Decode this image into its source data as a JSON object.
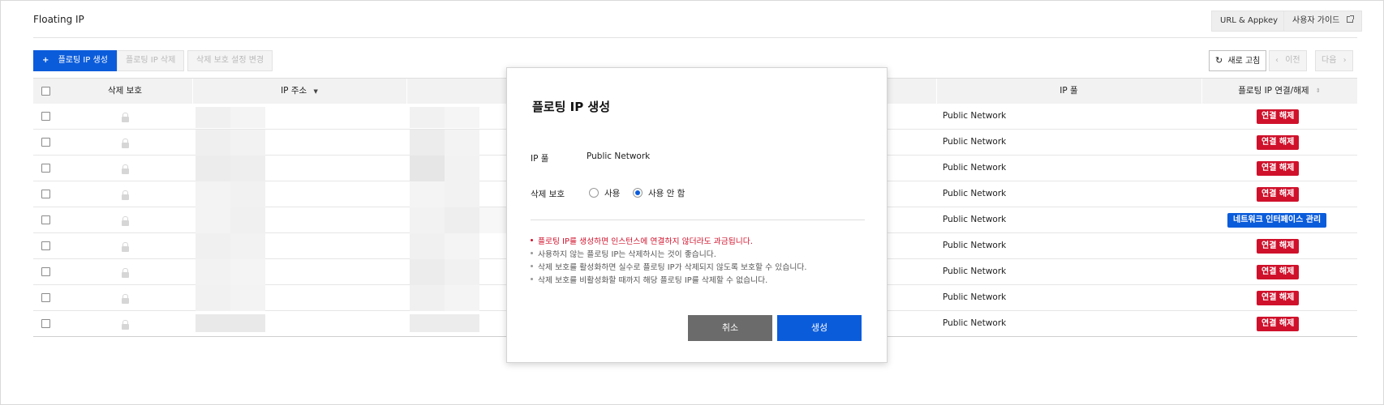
{
  "page": {
    "title": "Floating IP"
  },
  "header": {
    "url_appkey": "URL & Appkey",
    "user_guide": "사용자 가이드"
  },
  "toolbar": {
    "create": "플로팅 IP 생성",
    "delete": "플로팅 IP 삭제",
    "change_protection": "삭제 보호 설정 변경",
    "refresh": "새로 고침",
    "prev": "이전",
    "next": "다음"
  },
  "table": {
    "headers": {
      "protection": "삭제 보호",
      "ip_address": "IP 주소",
      "ip_pool": "IP 풀",
      "connect": "플로팅 IP 연결/해제"
    },
    "rows": [
      {
        "pool": "Public Network",
        "action": "연결 해제",
        "action_type": "disconnect"
      },
      {
        "pool": "Public Network",
        "action": "연결 해제",
        "action_type": "disconnect"
      },
      {
        "pool": "Public Network",
        "action": "연결 해제",
        "action_type": "disconnect"
      },
      {
        "pool": "Public Network",
        "action": "연결 해제",
        "action_type": "disconnect"
      },
      {
        "pool": "Public Network",
        "action": "네트워크 인터페이스 관리",
        "action_type": "manage"
      },
      {
        "pool": "Public Network",
        "action": "연결 해제",
        "action_type": "disconnect"
      },
      {
        "pool": "Public Network",
        "action": "연결 해제",
        "action_type": "disconnect"
      },
      {
        "pool": "Public Network",
        "action": "연결 해제",
        "action_type": "disconnect"
      },
      {
        "pool": "Public Network",
        "action": "연결 해제",
        "action_type": "disconnect"
      }
    ]
  },
  "modal": {
    "title": "플로팅 IP 생성",
    "ip_pool_label": "IP 풀",
    "ip_pool_value": "Public Network",
    "protection_label": "삭제 보호",
    "option_use": "사용",
    "option_no_use": "사용 안 함",
    "selected_option": "사용 안 함",
    "notes": [
      "플로팅 IP를 생성하면 인스턴스에 연결하지 않더라도 과금됩니다.",
      "사용하지 않는 플로팅 IP는 삭제하시는 것이 좋습니다.",
      "삭제 보호를 활성화하면 실수로 플로팅 IP가 삭제되지 않도록 보호할 수 있습니다.",
      "삭제 보호를 비활성화할 때까지 해당 플로팅 IP를 삭제할 수 없습니다."
    ],
    "cancel": "취소",
    "create": "생성"
  },
  "colors": {
    "primary": "#0b5cdb",
    "danger": "#d0112b",
    "cancel": "#6b6b6b",
    "header_bg": "#f2f2f2"
  }
}
